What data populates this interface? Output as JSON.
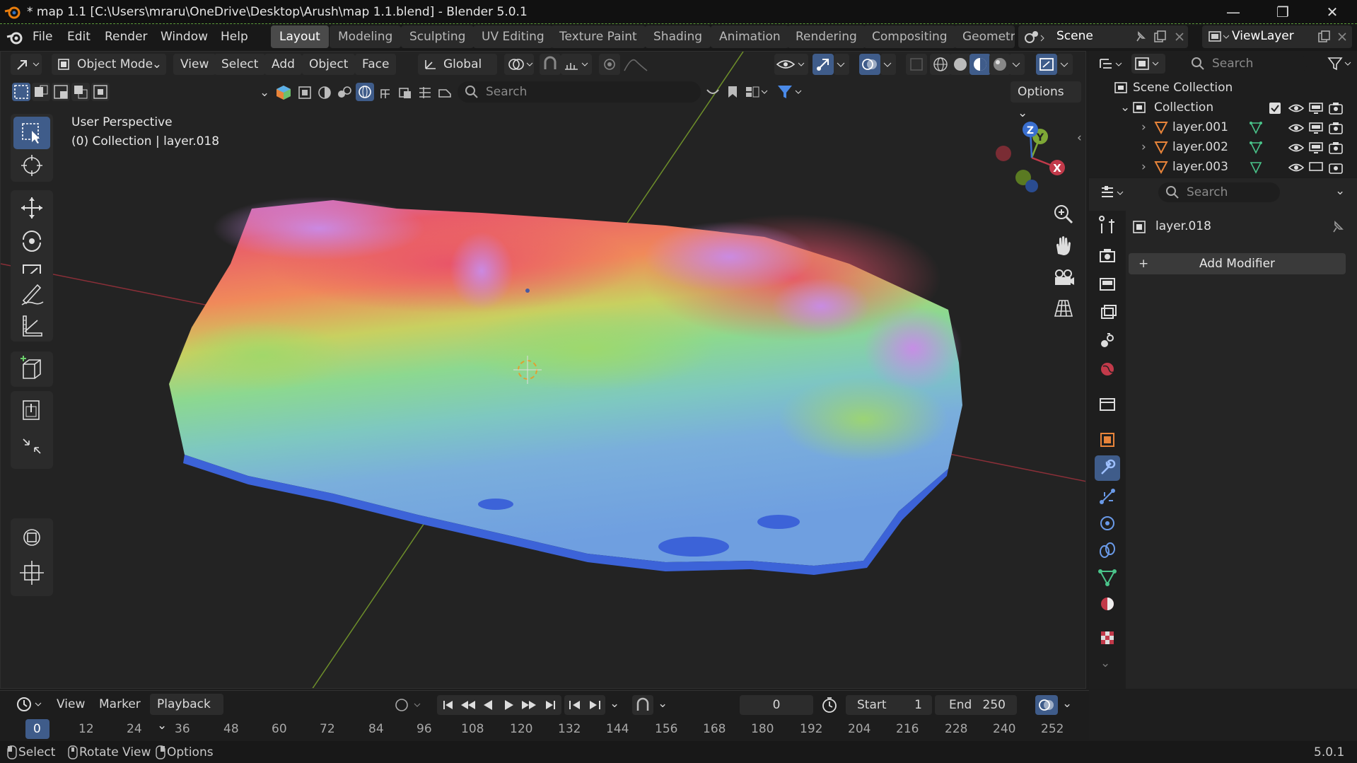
{
  "window": {
    "title": "* map 1.1 [C:\\Users\\mraru\\OneDrive\\Desktop\\Arush\\map 1.1.blend] - Blender 5.0.1",
    "minimize": "—",
    "maximize": "❐",
    "close": "✕"
  },
  "menu": [
    "File",
    "Edit",
    "Render",
    "Window",
    "Help"
  ],
  "workspaces": [
    "Layout",
    "Modeling",
    "Sculpting",
    "UV Editing",
    "Texture Paint",
    "Shading",
    "Animation",
    "Rendering",
    "Compositing",
    "Geometr"
  ],
  "scene": "Scene",
  "view_layer": "ViewLayer",
  "viewport": {
    "mode": "Object Mode",
    "header_menu": [
      "View",
      "Select",
      "Add",
      "Object",
      "Face"
    ],
    "orientation": "Global",
    "search_placeholder": "Search",
    "options": "Options",
    "perspective": "User Perspective",
    "collection_info": "(0) Collection | layer.018",
    "gizmo": {
      "x": "X",
      "y": "Y",
      "z": "Z"
    }
  },
  "outliner": {
    "search_placeholder": "Search",
    "scene_collection": "Scene Collection",
    "collection": "Collection",
    "items": [
      "layer.001",
      "layer.002",
      "layer.003"
    ]
  },
  "properties": {
    "search_placeholder": "Search",
    "object_name": "layer.018",
    "add_modifier": "Add Modifier"
  },
  "timeline": {
    "menus": [
      "View",
      "Marker",
      "Playback"
    ],
    "current_frame": "0",
    "start_label": "Start",
    "start_value": "1",
    "end_label": "End",
    "end_value": "250",
    "ticks": [
      "0",
      "12",
      "24",
      "36",
      "48",
      "60",
      "72",
      "84",
      "96",
      "108",
      "120",
      "132",
      "144",
      "156",
      "168",
      "180",
      "192",
      "204",
      "216",
      "228",
      "240",
      "252"
    ]
  },
  "status": {
    "select": "Select",
    "rotate": "Rotate View",
    "options": "Options",
    "version": "5.0.1"
  },
  "colors": {
    "accent": "#3f5c8a",
    "axis_x": "#c23a4a",
    "axis_y": "#7ea836",
    "axis_z": "#3a6fcf"
  }
}
